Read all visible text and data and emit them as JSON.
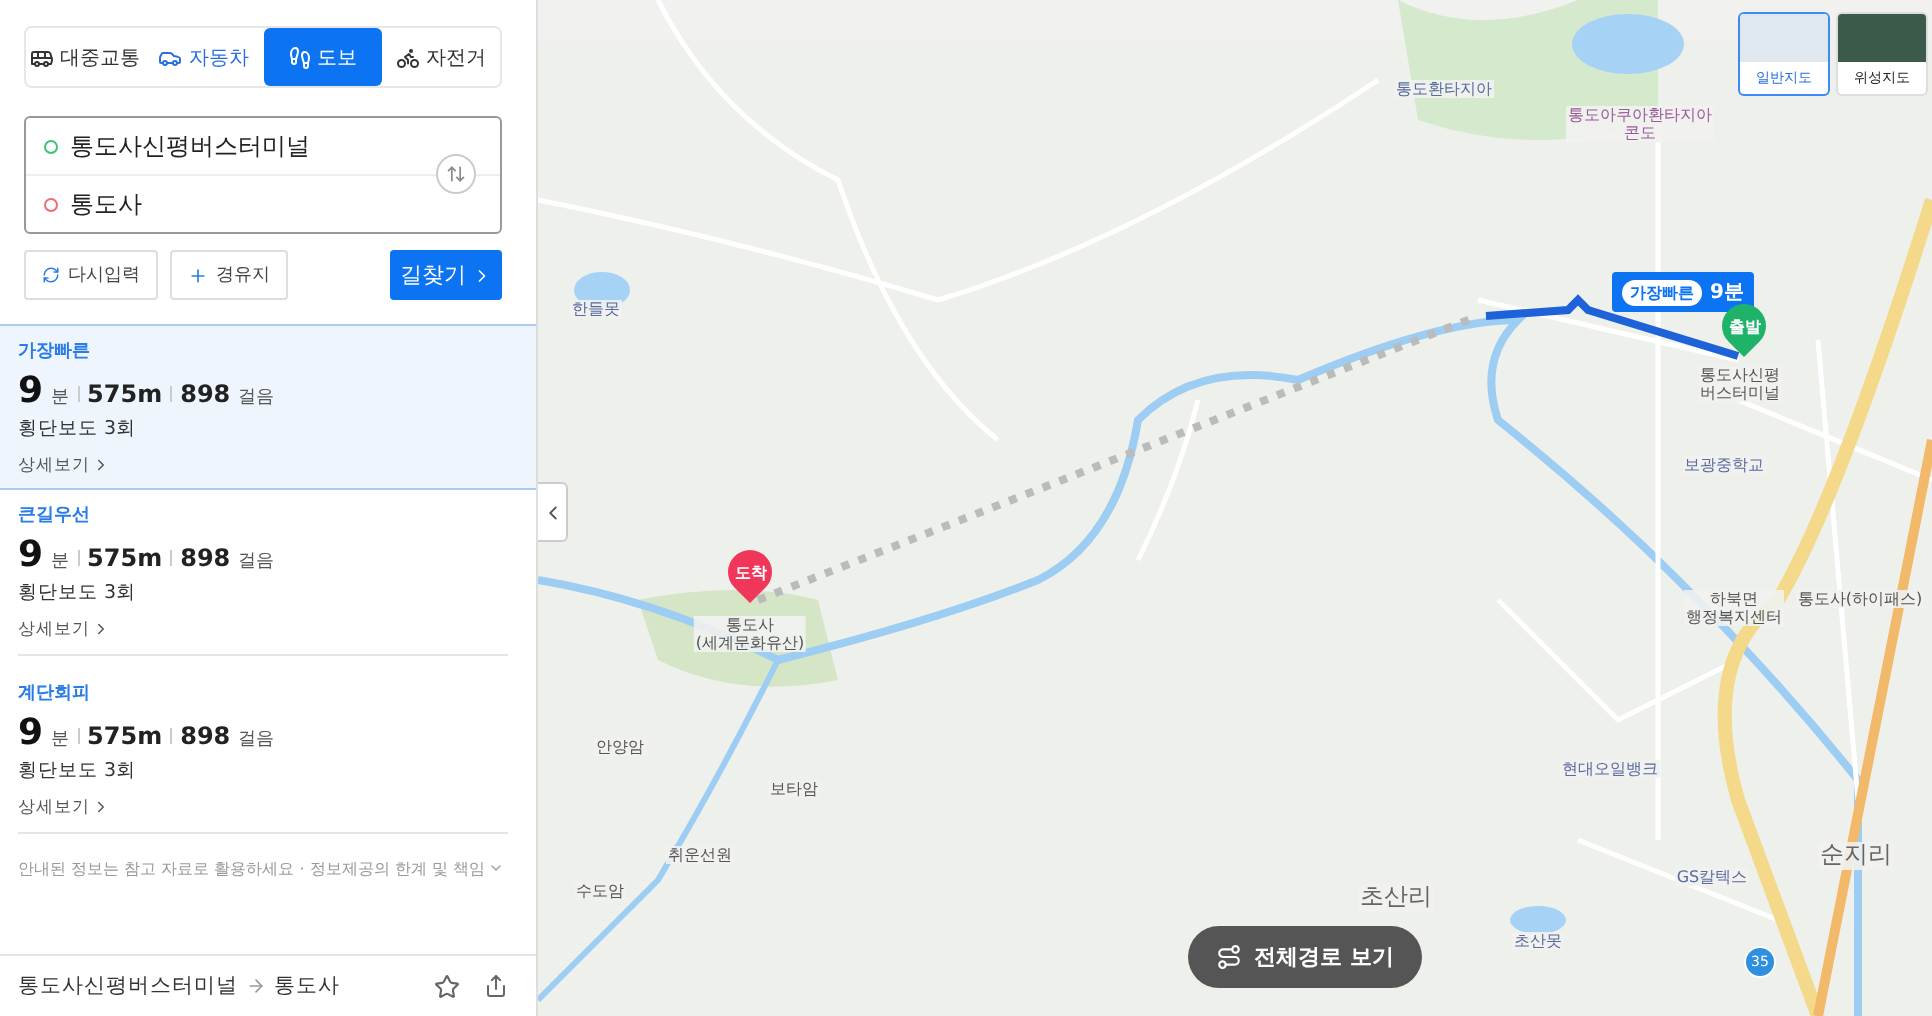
{
  "mode_tabs": [
    {
      "kind": "transit",
      "label": "대중교통",
      "selected": false
    },
    {
      "kind": "car",
      "label": "자동차",
      "selected": false
    },
    {
      "kind": "walk",
      "label": "도보",
      "selected": true
    },
    {
      "kind": "bike",
      "label": "자전거",
      "selected": false
    }
  ],
  "route_inputs": {
    "origin": "통도사신평버스터미널",
    "destination": "통도사"
  },
  "buttons": {
    "reset": "다시입력",
    "waypoint": "경유지",
    "search": "길찾기"
  },
  "routes": [
    {
      "label": "가장빠른",
      "minutes": "9",
      "unit": "분",
      "distance": "575m",
      "steps": "898",
      "steps_unit": "걸음",
      "crossings": "횡단보도 3회",
      "detail": "상세보기",
      "selected": true
    },
    {
      "label": "큰길우선",
      "minutes": "9",
      "unit": "분",
      "distance": "575m",
      "steps": "898",
      "steps_unit": "걸음",
      "crossings": "횡단보도 3회",
      "detail": "상세보기",
      "selected": false
    },
    {
      "label": "계단회피",
      "minutes": "9",
      "unit": "분",
      "distance": "575m",
      "steps": "898",
      "steps_unit": "걸음",
      "crossings": "횡단보도 3회",
      "detail": "상세보기",
      "selected": false
    }
  ],
  "disclaimer": "안내된 정보는 참고 자료로 활용하세요 · 정보제공의 한계 및 책임",
  "footer": {
    "from": "통도사신평버스터미널",
    "to": "통도사"
  },
  "map": {
    "type_buttons": [
      {
        "label": "일반지도",
        "selected": true
      },
      {
        "label": "위성지도",
        "selected": false
      }
    ],
    "route_badge": {
      "label": "가장빠른",
      "time": "9분"
    },
    "start_pin": "출발",
    "end_pin": "도착",
    "overview_button": "전체경로 보기",
    "road_number": "35",
    "labels": [
      {
        "text": "통도환타지아",
        "kind": "poi"
      },
      {
        "text": "통도아쿠아환타지아\n콘도",
        "kind": "hotel"
      },
      {
        "text": "한들못",
        "kind": "poi"
      },
      {
        "text": "통도사신평\n버스터미널",
        "kind": "place"
      },
      {
        "text": "보광중학교",
        "kind": "poi"
      },
      {
        "text": "통도사\n(세계문화유산)",
        "kind": "place"
      },
      {
        "text": "하북면\n행정복지센터",
        "kind": "place"
      },
      {
        "text": "통도사(하이패스)",
        "kind": "place"
      },
      {
        "text": "안양암",
        "kind": "place"
      },
      {
        "text": "보타암",
        "kind": "place"
      },
      {
        "text": "취운선원",
        "kind": "place"
      },
      {
        "text": "수도암",
        "kind": "place"
      },
      {
        "text": "현대오일뱅크",
        "kind": "poi"
      },
      {
        "text": "GS칼텍스",
        "kind": "poi"
      },
      {
        "text": "초산리",
        "kind": "area"
      },
      {
        "text": "초산못",
        "kind": "poi"
      },
      {
        "text": "순지리",
        "kind": "area"
      }
    ]
  }
}
